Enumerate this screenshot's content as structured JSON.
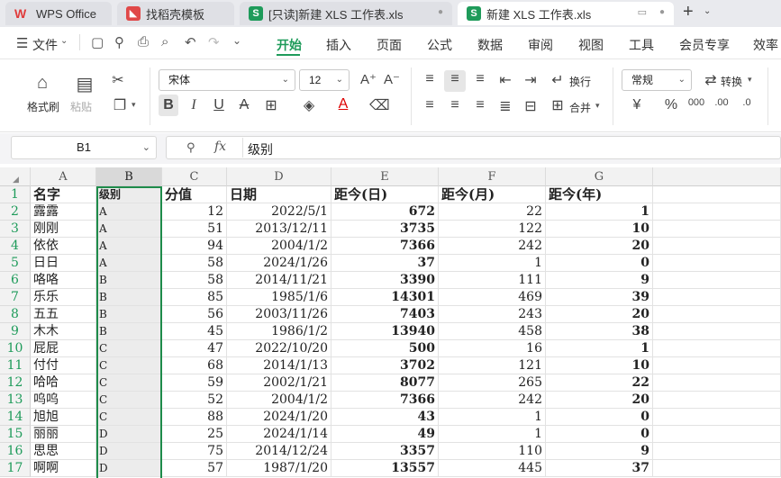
{
  "tabs": [
    {
      "label": "WPS Office",
      "icon": "wps-logo-icon"
    },
    {
      "label": "找稻壳模板",
      "icon": "docer-template-icon"
    },
    {
      "label": "[只读]新建 XLS 工作表.xls",
      "icon": "spreadsheet-icon"
    },
    {
      "label": "新建 XLS 工作表.xls",
      "icon": "spreadsheet-icon"
    }
  ],
  "new_tab_label": "+",
  "menu": {
    "file_label": "文件",
    "items": [
      "开始",
      "插入",
      "页面",
      "公式",
      "数据",
      "审阅",
      "视图",
      "工具",
      "会员专享",
      "效率"
    ],
    "active": "开始"
  },
  "ribbon": {
    "format_painter": "格式刷",
    "paste": "粘贴",
    "font_name": "宋体",
    "font_size": "12",
    "wrap_text": "换行",
    "number_format": "常规",
    "convert": "转换",
    "merge": "合并"
  },
  "formula_bar": {
    "name_box": "B1",
    "fx_label": "fx",
    "content": "级别"
  },
  "colors": {
    "accent": "#1e9b5a",
    "selection_border": "#1e8b4a"
  },
  "sheet": {
    "columns": [
      "A",
      "B",
      "C",
      "D",
      "E",
      "F",
      "G"
    ],
    "header_row": [
      "名字",
      "级别",
      "分值",
      "日期",
      "距今(日)",
      "距今(月)",
      "距今(年)"
    ],
    "rows": [
      [
        "露露",
        "A",
        "12",
        "2022/5/1",
        "672",
        "22",
        "1"
      ],
      [
        "刚刚",
        "A",
        "51",
        "2013/12/11",
        "3735",
        "122",
        "10"
      ],
      [
        "依依",
        "A",
        "94",
        "2004/1/2",
        "7366",
        "242",
        "20"
      ],
      [
        "日日",
        "A",
        "58",
        "2024/1/26",
        "37",
        "1",
        "0"
      ],
      [
        "咯咯",
        "B",
        "58",
        "2014/11/21",
        "3390",
        "111",
        "9"
      ],
      [
        "乐乐",
        "B",
        "85",
        "1985/1/6",
        "14301",
        "469",
        "39"
      ],
      [
        "五五",
        "B",
        "56",
        "2003/11/26",
        "7403",
        "243",
        "20"
      ],
      [
        "木木",
        "B",
        "45",
        "1986/1/2",
        "13940",
        "458",
        "38"
      ],
      [
        "屁屁",
        "C",
        "47",
        "2022/10/20",
        "500",
        "16",
        "1"
      ],
      [
        "付付",
        "C",
        "68",
        "2014/1/13",
        "3702",
        "121",
        "10"
      ],
      [
        "哈哈",
        "C",
        "59",
        "2002/1/21",
        "8077",
        "265",
        "22"
      ],
      [
        "呜呜",
        "C",
        "52",
        "2004/1/2",
        "7366",
        "242",
        "20"
      ],
      [
        "旭旭",
        "C",
        "88",
        "2024/1/20",
        "43",
        "1",
        "0"
      ],
      [
        "丽丽",
        "D",
        "25",
        "2024/1/14",
        "49",
        "1",
        "0"
      ],
      [
        "思思",
        "D",
        "75",
        "2014/12/24",
        "3357",
        "110",
        "9"
      ],
      [
        "啊啊",
        "D",
        "57",
        "1987/1/20",
        "13557",
        "445",
        "37"
      ]
    ]
  }
}
